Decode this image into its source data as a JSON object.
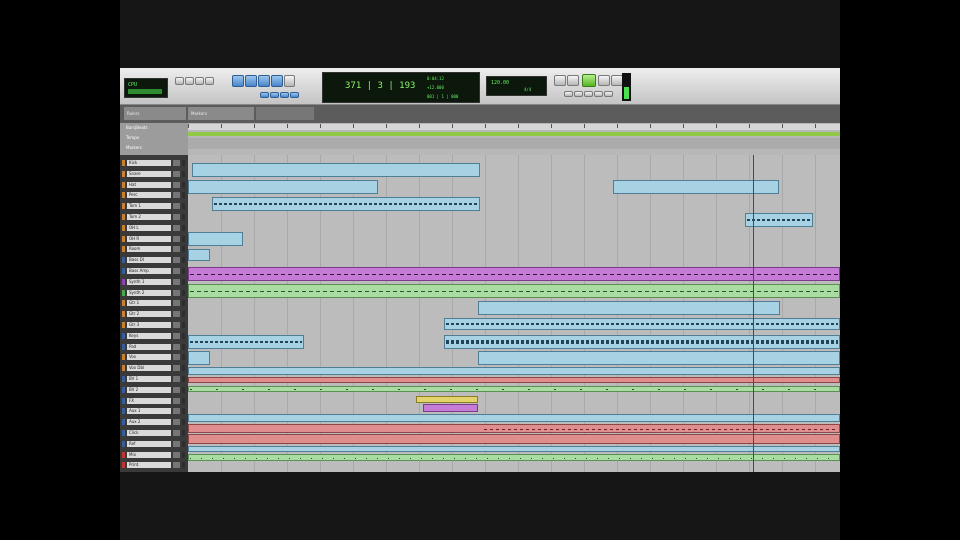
{
  "toolbar": {
    "counter_main": "371 | 3 | 193",
    "counter_small": [
      "0:04:12",
      "+12.000",
      "001 | 1 | 000"
    ],
    "cpu_label": "CPU",
    "tempo_display": "120.00",
    "meter_display": "4/4"
  },
  "rulers": {
    "tabs": [
      "Rulers",
      "Markers"
    ],
    "labels": [
      "Bars|Beats",
      "Tempo",
      "Markers"
    ]
  },
  "tracks": [
    {
      "name": "Kick",
      "color": "#c78031"
    },
    {
      "name": "Snare",
      "color": "#c78031"
    },
    {
      "name": "Hat",
      "color": "#c78031"
    },
    {
      "name": "Perc",
      "color": "#c78031"
    },
    {
      "name": "Tom 1",
      "color": "#c78031"
    },
    {
      "name": "Tom 2",
      "color": "#c78031"
    },
    {
      "name": "OH L",
      "color": "#c78031"
    },
    {
      "name": "OH R",
      "color": "#c78031"
    },
    {
      "name": "Room",
      "color": "#c78031"
    },
    {
      "name": "Bass DI",
      "color": "#365d9b"
    },
    {
      "name": "Bass Amp",
      "color": "#365d9b"
    },
    {
      "name": "Synth 1",
      "color": "#8e42ad"
    },
    {
      "name": "Synth 2",
      "color": "#49a84d"
    },
    {
      "name": "Gtr 1",
      "color": "#c78031"
    },
    {
      "name": "Gtr 2",
      "color": "#c78031"
    },
    {
      "name": "Gtr 3",
      "color": "#c78031"
    },
    {
      "name": "Keys",
      "color": "#365d9b"
    },
    {
      "name": "Pad",
      "color": "#365d9b"
    },
    {
      "name": "Vox",
      "color": "#c78031"
    },
    {
      "name": "Vox Dbl",
      "color": "#c78031"
    },
    {
      "name": "BV 1",
      "color": "#365d9b"
    },
    {
      "name": "BV 2",
      "color": "#365d9b"
    },
    {
      "name": "FX",
      "color": "#365d9b"
    },
    {
      "name": "Aux 1",
      "color": "#365d9b"
    },
    {
      "name": "Aux 2",
      "color": "#365d9b"
    },
    {
      "name": "Click",
      "color": "#365d9b"
    },
    {
      "name": "Ref",
      "color": "#365d9b"
    },
    {
      "name": "Mix",
      "color": "#c43333"
    },
    {
      "name": "Print",
      "color": "#c43333"
    }
  ]
}
